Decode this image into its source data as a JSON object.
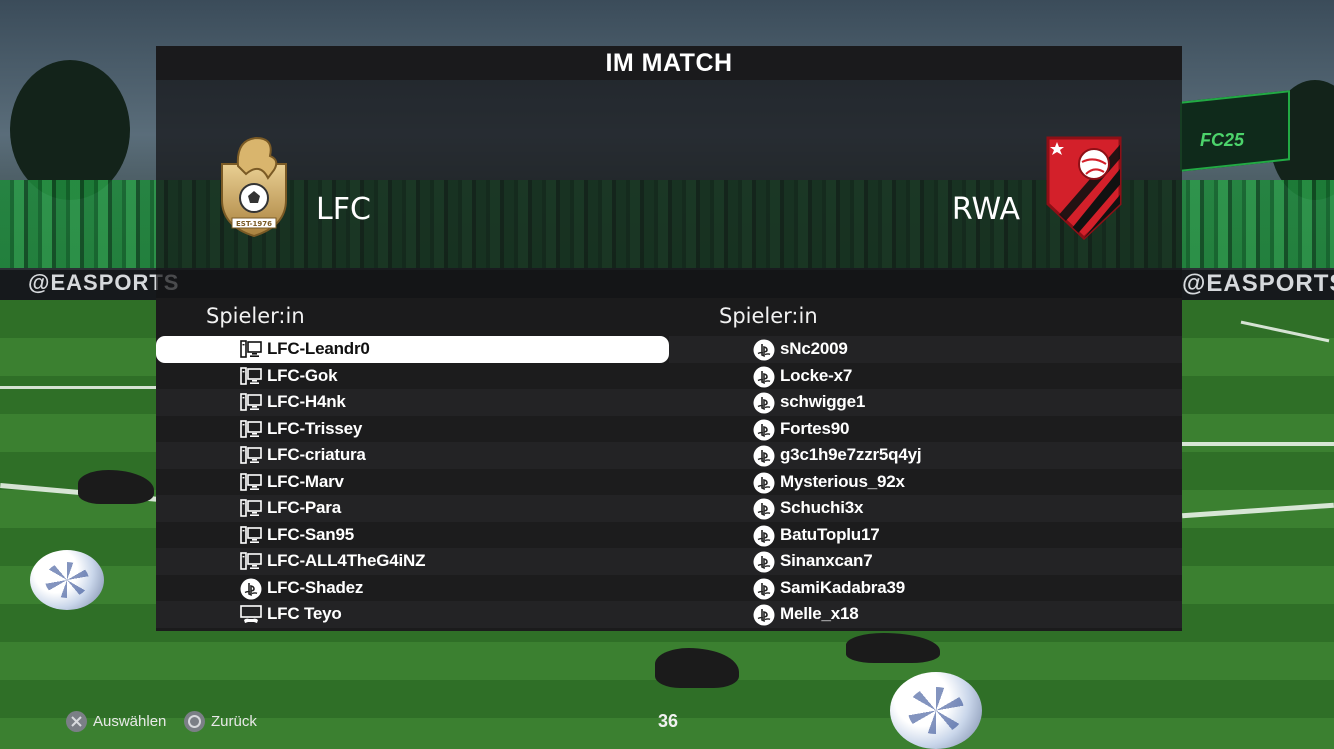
{
  "screen": {
    "title": "IM MATCH"
  },
  "home_team": {
    "name": "LFC",
    "crest_text": "EST-1976",
    "column_header": "Spieler:in",
    "players": [
      {
        "name": "LFC-Leandr0",
        "platform": "pc-icon",
        "selected": true
      },
      {
        "name": "LFC-Gok",
        "platform": "pc-icon"
      },
      {
        "name": "LFC-H4nk",
        "platform": "pc-icon"
      },
      {
        "name": "LFC-Trissey",
        "platform": "pc-icon"
      },
      {
        "name": "LFC-criatura",
        "platform": "pc-icon"
      },
      {
        "name": "LFC-Marv",
        "platform": "pc-icon"
      },
      {
        "name": "LFC-Para",
        "platform": "pc-icon"
      },
      {
        "name": "LFC-San95",
        "platform": "pc-icon"
      },
      {
        "name": "LFC-ALL4TheG4iNZ",
        "platform": "pc-icon"
      },
      {
        "name": "LFC-Shadez",
        "platform": "playstation-icon"
      },
      {
        "name": "LFC Teyo",
        "platform": "controller-screen-icon"
      }
    ]
  },
  "away_team": {
    "name": "RWA",
    "column_header": "Spieler:in",
    "players": [
      {
        "name": "sNc2009",
        "platform": "playstation-icon"
      },
      {
        "name": "Locke-x7",
        "platform": "playstation-icon"
      },
      {
        "name": "schwigge1",
        "platform": "playstation-icon"
      },
      {
        "name": "Fortes90",
        "platform": "playstation-icon"
      },
      {
        "name": "g3c1h9e7zzr5q4yj",
        "platform": "playstation-icon"
      },
      {
        "name": "Mysterious_92x",
        "platform": "playstation-icon"
      },
      {
        "name": "Schuchi3x",
        "platform": "playstation-icon"
      },
      {
        "name": "BatuToplu17",
        "platform": "playstation-icon"
      },
      {
        "name": "Sinanxcan7",
        "platform": "playstation-icon"
      },
      {
        "name": "SamiKadabra39",
        "platform": "playstation-icon"
      },
      {
        "name": "Melle_x18",
        "platform": "playstation-icon"
      }
    ]
  },
  "footer": {
    "select_label": "Auswählen",
    "back_label": "Zurück",
    "counter": "36"
  },
  "background": {
    "board_text_1": "@EASPORTS",
    "board_text_2": "@EASPORTSFC",
    "board_text_3": "@EASPORTSFC",
    "banner_text": "FC25"
  },
  "colors": {
    "away_crest_red": "#d3202a",
    "away_crest_black": "#111111",
    "home_crest_gold": "#c9a25a",
    "selected_row": "#ffffff"
  }
}
